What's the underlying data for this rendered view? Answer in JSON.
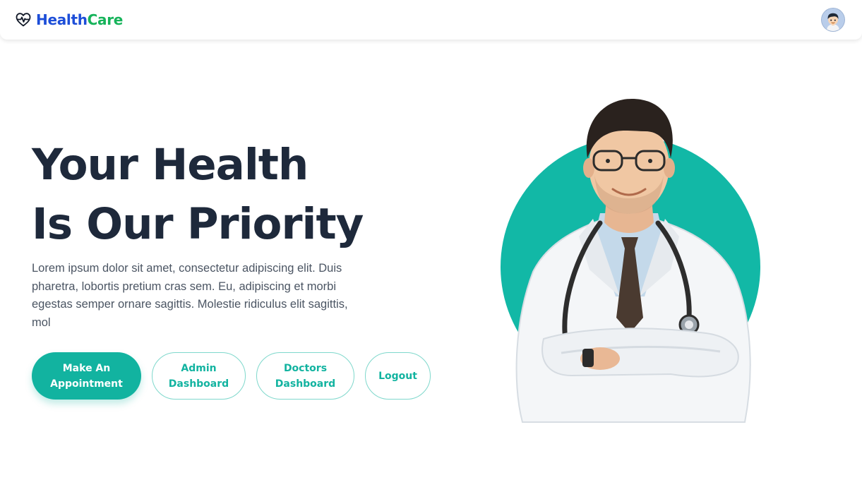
{
  "brand": {
    "name_part1": "Health",
    "name_part2": "Care",
    "icon": "heart-pulse-icon",
    "color_primary": "#1d4ed8",
    "color_secondary": "#16b35a"
  },
  "header": {
    "avatar": "user-avatar"
  },
  "hero": {
    "title_line1": "Your Health",
    "title_line2": "Is Our Priority",
    "description": "Lorem ipsum dolor sit amet, consectetur adipiscing elit. Duis pharetra, lobortis pretium cras sem. Eu, adipiscing et morbi egestas semper ornare sagittis. Molestie ridiculus elit sagittis, mol",
    "accent_color": "#12b3a0"
  },
  "buttons": {
    "appointment_line1": "Make An",
    "appointment_line2": "Appointment",
    "admin_line1": "Admin",
    "admin_line2": "Dashboard",
    "doctors_line1": "Doctors",
    "doctors_line2": "Dashboard",
    "logout": "Logout"
  }
}
